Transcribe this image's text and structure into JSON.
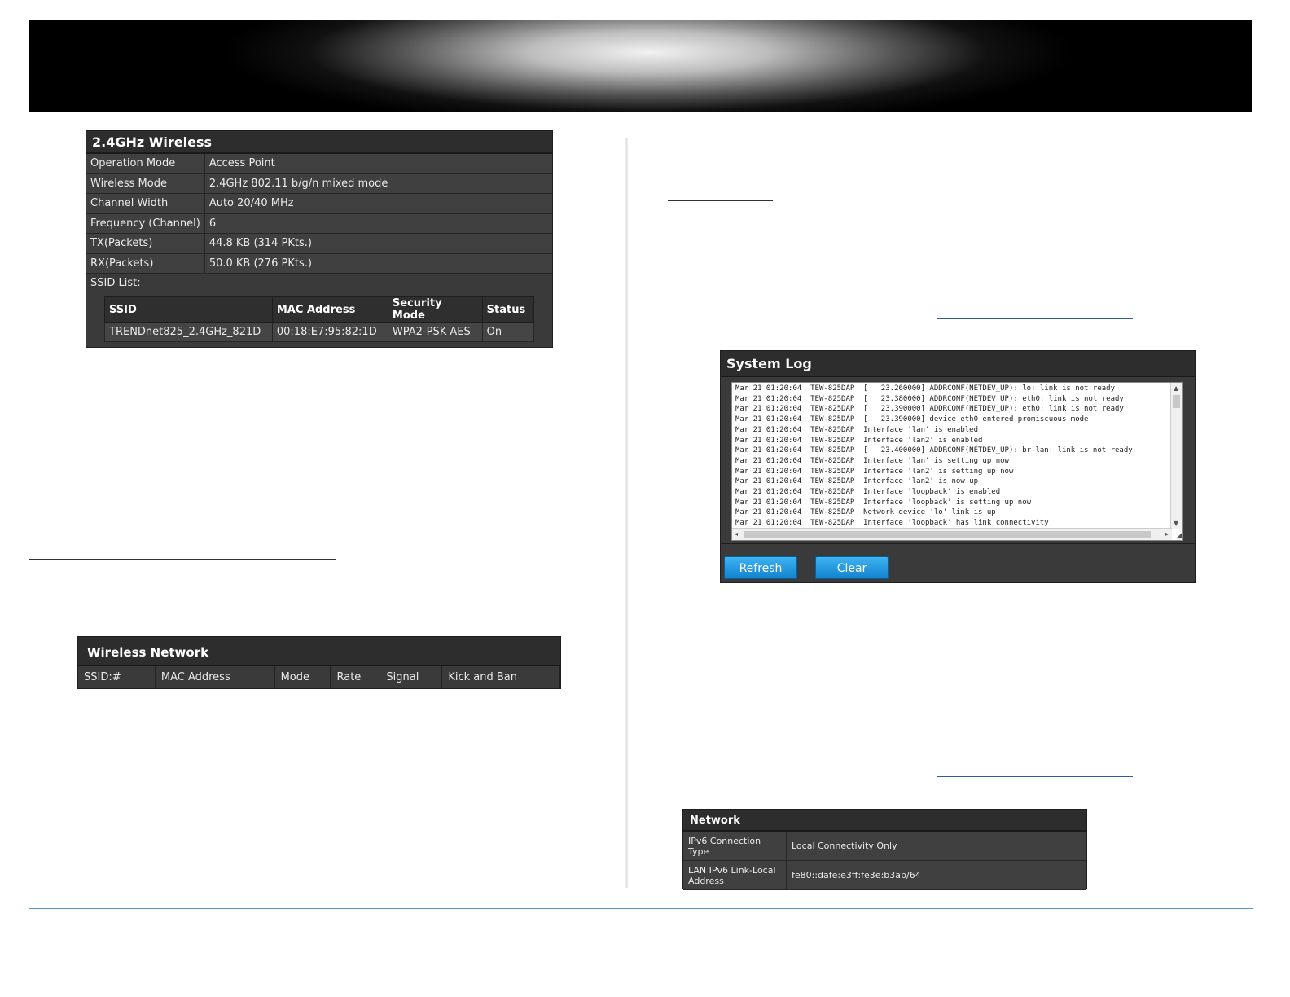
{
  "wireless24": {
    "title": "2.4GHz Wireless",
    "rows": [
      {
        "label": "Operation Mode",
        "value": "Access Point"
      },
      {
        "label": "Wireless Mode",
        "value": "2.4GHz 802.11 b/g/n mixed mode"
      },
      {
        "label": "Channel Width",
        "value": "Auto 20/40 MHz"
      },
      {
        "label": "Frequency (Channel)",
        "value": "6"
      },
      {
        "label": "TX(Packets)",
        "value": "44.8 KB (314 PKts.)"
      },
      {
        "label": "RX(Packets)",
        "value": "50.0 KB (276 PKts.)"
      }
    ],
    "ssid_list_label": "SSID List:",
    "ssid_headers": [
      "SSID",
      "MAC Address",
      "Security Mode",
      "Status"
    ],
    "ssid_rows": [
      [
        "TRENDnet825_2.4GHz_821D",
        "00:18:E7:95:82:1D",
        "WPA2-PSK AES",
        "On"
      ]
    ]
  },
  "wireless_network": {
    "title": "Wireless Network",
    "headers": [
      "SSID:#",
      "MAC Address",
      "Mode",
      "Rate",
      "Signal",
      "Kick and Ban"
    ]
  },
  "system_log": {
    "title": "System Log",
    "lines": [
      "Mar 21 01:20:04  TEW-825DAP  [   23.260000] ADDRCONF(NETDEV_UP): lo: link is not ready",
      "Mar 21 01:20:04  TEW-825DAP  [   23.380000] ADDRCONF(NETDEV_UP): eth0: link is not ready",
      "Mar 21 01:20:04  TEW-825DAP  [   23.390000] ADDRCONF(NETDEV_UP): eth0: link is not ready",
      "Mar 21 01:20:04  TEW-825DAP  [   23.390000] device eth0 entered promiscuous mode",
      "Mar 21 01:20:04  TEW-825DAP  Interface 'lan' is enabled",
      "Mar 21 01:20:04  TEW-825DAP  Interface 'lan2' is enabled",
      "Mar 21 01:20:04  TEW-825DAP  [   23.400000] ADDRCONF(NETDEV_UP): br-lan: link is not ready",
      "Mar 21 01:20:04  TEW-825DAP  Interface 'lan' is setting up now",
      "Mar 21 01:20:04  TEW-825DAP  Interface 'lan2' is setting up now",
      "Mar 21 01:20:04  TEW-825DAP  Interface 'lan2' is now up",
      "Mar 21 01:20:04  TEW-825DAP  Interface 'loopback' is enabled",
      "Mar 21 01:20:04  TEW-825DAP  Interface 'loopback' is setting up now",
      "Mar 21 01:20:04  TEW-825DAP  Network device 'lo' link is up",
      "Mar 21 01:20:04  TEW-825DAP  Interface 'loopback' has link connectivity"
    ],
    "refresh_label": "Refresh",
    "clear_label": "Clear"
  },
  "network": {
    "title": "Network",
    "rows": [
      {
        "label": "IPv6 Connection Type",
        "value": "Local Connectivity Only"
      },
      {
        "label": "LAN IPv6 Link-Local Address",
        "value": "fe80::dafe:e3ff:fe3e:b3ab/64"
      }
    ]
  },
  "colors": {
    "panel_bg": "#3a3a3a",
    "button_blue": "#1283cf",
    "footer_rule": "#5b8fc6"
  }
}
